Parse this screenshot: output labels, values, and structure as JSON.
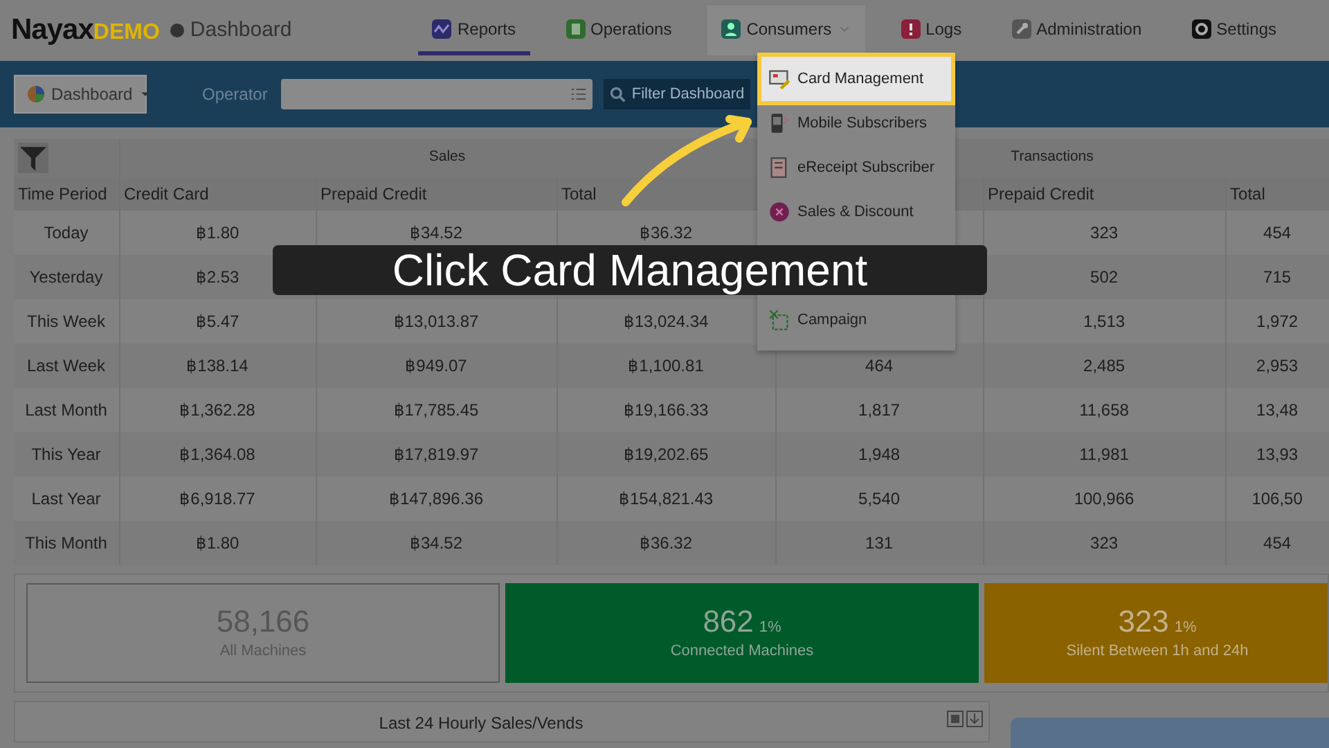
{
  "caption": "Click Card Management",
  "header": {
    "logo": "Nayax",
    "logo_suffix": "DEMO",
    "page": "Dashboard",
    "nav": [
      {
        "label": "Reports",
        "kind": "reports",
        "selected": true,
        "expanded": false
      },
      {
        "label": "Operations",
        "kind": "operations",
        "selected": false,
        "expanded": false
      },
      {
        "label": "Consumers",
        "kind": "consumers",
        "selected": false,
        "expanded": true
      },
      {
        "label": "Logs",
        "kind": "logs",
        "selected": false,
        "expanded": false
      },
      {
        "label": "Administration",
        "kind": "administration",
        "selected": false,
        "expanded": false
      },
      {
        "label": "Settings",
        "kind": "settings",
        "selected": false,
        "expanded": false
      }
    ]
  },
  "menu": [
    {
      "label": "Card Management",
      "kind": "card",
      "selected": true
    },
    {
      "label": "Mobile Subscribers",
      "kind": "mobile",
      "selected": false
    },
    {
      "label": "eReceipt Subscriber",
      "kind": "receipt",
      "selected": false
    },
    {
      "label": "Sales & Discount",
      "kind": "discount",
      "selected": false
    },
    {
      "label": "Campaign",
      "kind": "campaign",
      "selected": false
    }
  ],
  "toolbar": {
    "view_button": "Dashboard",
    "operator_label": "Operator",
    "filter_button": "Filter Dashboard"
  },
  "table": {
    "groups": [
      {
        "label": "Sales"
      },
      {
        "label": "Transactions"
      }
    ],
    "columns": [
      {
        "label": "Time Period"
      },
      {
        "label": "Credit Card"
      },
      {
        "label": "Prepaid Credit"
      },
      {
        "label": "Total"
      },
      {},
      {
        "label": "Prepaid Credit"
      },
      {
        "label": "Total"
      }
    ],
    "rows": [
      [
        "Today",
        "฿1.80",
        "฿34.52",
        "฿36.32",
        null,
        "323",
        "454"
      ],
      [
        "Yesterday",
        "฿2.53",
        null,
        null,
        null,
        "502",
        "715"
      ],
      [
        "This Week",
        "฿5.47",
        "฿13,013.87",
        "฿13,024.34",
        null,
        "1,513",
        "1,972"
      ],
      [
        "Last Week",
        "฿138.14",
        "฿949.07",
        "฿1,100.81",
        "464",
        "2,485",
        "2,953"
      ],
      [
        "Last Month",
        "฿1,362.28",
        "฿17,785.45",
        "฿19,166.33",
        "1,817",
        "11,658",
        "13,48"
      ],
      [
        "This Year",
        "฿1,364.08",
        "฿17,819.97",
        "฿19,202.65",
        "1,948",
        "11,981",
        "13,93"
      ],
      [
        "Last Year",
        "฿6,918.77",
        "฿147,896.36",
        "฿154,821.43",
        "5,540",
        "100,966",
        "106,50"
      ],
      [
        "This Month",
        "฿1.80",
        "฿34.52",
        "฿36.32",
        "131",
        "323",
        "454"
      ]
    ]
  },
  "stats": [
    {
      "value": "58,166",
      "label": "All Machines",
      "kind": "outline"
    },
    {
      "value": "862",
      "percent": "1%",
      "label": "Connected Machines",
      "kind": "success"
    },
    {
      "value": "323",
      "percent": "1%",
      "label": "Silent Between 1h and 24h",
      "kind": "warning"
    }
  ],
  "chart_panel": {
    "title": "Last 24 Hourly Sales/Vends"
  }
}
